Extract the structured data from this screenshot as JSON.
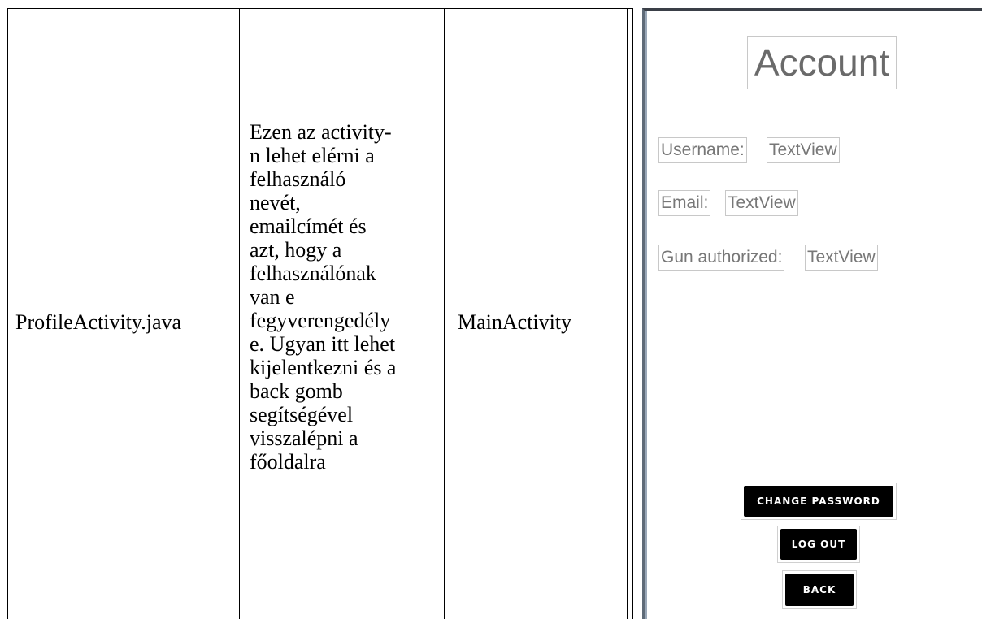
{
  "table": {
    "file_name": "ProfileActivity.java",
    "description": "Ezen az activity-\nn lehet elérni a\nfelhasználó\nnevét,\nemailcímét és\nazt, hogy a\nfelhasználónak\nvan e\nfegyverengedély\ne. Ugyan itt lehet\nkijelentkezni és a\nback gomb\nsegítségével\nvisszalépni a\nfőoldalra",
    "parent": "MainActivity"
  },
  "screen": {
    "title": "Account",
    "fields": [
      {
        "label": "Username:",
        "value": "TextView"
      },
      {
        "label": "Email:",
        "value": "TextView"
      },
      {
        "label": "Gun authorized:",
        "value": "TextView"
      }
    ],
    "buttons": {
      "change_password": "CHANGE PASSWORD",
      "log_out": "LOG OUT",
      "back": "BACK"
    }
  }
}
